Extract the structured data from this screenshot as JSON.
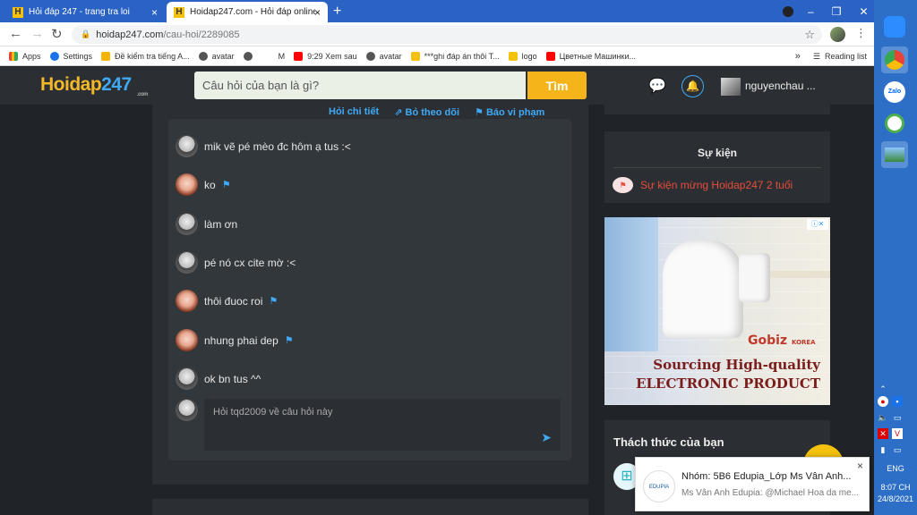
{
  "browser": {
    "tabs": [
      {
        "title": "Hỏi đáp 247 - trang tra loi",
        "close": "×",
        "active": false
      },
      {
        "title": "Hoidap247.com - Hỏi đáp online",
        "close": "×",
        "active": true
      }
    ],
    "new_tab": "+",
    "window_controls": [
      "–",
      "❐",
      "✕"
    ],
    "url": {
      "domain": "hoidap247.com",
      "path": "/cau-hoi/2289085"
    },
    "bookmarks": [
      {
        "label": "Apps",
        "color": "#ea4335"
      },
      {
        "label": "Settings",
        "color": "#1a73e8"
      },
      {
        "label": "Đề kiểm tra tiếng A...",
        "color": "#f4b400"
      },
      {
        "label": "avatar",
        "color": "#555555"
      },
      {
        "label": "",
        "color": "#555555"
      },
      {
        "label": "M",
        "color": "#ffffff"
      },
      {
        "label": "9:29 Xem sau",
        "color": "#ff0000"
      },
      {
        "label": "avatar",
        "color": "#555555"
      },
      {
        "label": "***ghi đáp án thôi T...",
        "color": "#f4c20d"
      },
      {
        "label": "logo",
        "color": "#f4c20d"
      },
      {
        "label": "Цветные Машинки...",
        "color": "#ff0000"
      }
    ],
    "bookmarks_more": "»",
    "reading_list": "Reading list"
  },
  "site": {
    "logo": {
      "main": "Hoidap",
      "num": "247",
      "sub": ".com"
    },
    "search_placeholder": "Câu hỏi của bạn là gì?",
    "search_button": "Tìm",
    "username": "nguyenchau ...",
    "actions": [
      "Hỏi chi tiết",
      "Bỏ theo dõi",
      "Báo vi phạm"
    ],
    "comments": [
      {
        "text": "mik vẽ pé mèo đc hôm ạ tus :<",
        "avatar": "grey",
        "flag": false
      },
      {
        "text": "ko",
        "avatar": "cat",
        "flag": true
      },
      {
        "text": "làm ơn",
        "avatar": "grey",
        "flag": false
      },
      {
        "text": "pé nó cx cite mờ :<",
        "avatar": "grey",
        "flag": false
      },
      {
        "text": "thôi đuoc roi",
        "avatar": "cat",
        "flag": true
      },
      {
        "text": "nhung phai dep",
        "avatar": "cat",
        "flag": true
      },
      {
        "text": "ok bn tus ^^",
        "avatar": "grey",
        "flag": false
      }
    ],
    "reply_placeholder": "Hỏi tqd2009 về câu hỏi này",
    "event_title": "Sự kiện",
    "event_link": "Sự kiện mừng Hoidap247 2 tuổi",
    "ad": {
      "brand": "Gobiz",
      "brand_sub": "KOREA",
      "line1": "Sourcing High-quality",
      "line2": "ELECTRONIC PRODUCT"
    },
    "challenge_title": "Thách thức của bạn"
  },
  "notification": {
    "app": "EDUPIA",
    "title": "Nhóm: 5B6 Edupia_Lớp Ms Vân Anh...",
    "message": "Ms Vân Anh Edupia: @Michael Hoa da me...",
    "close": "×"
  },
  "taskbar": {
    "lang": "ENG",
    "time": "8:07 CH",
    "date": "24/8/2021"
  }
}
